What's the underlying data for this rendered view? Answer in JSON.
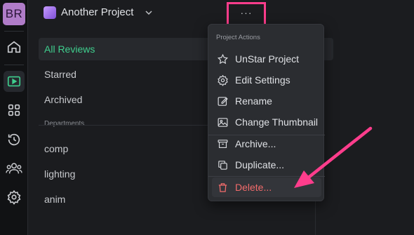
{
  "rail": {
    "avatar_initials": "BR",
    "items": [
      {
        "icon": "home-icon"
      },
      {
        "icon": "reviews-icon",
        "active": true
      },
      {
        "icon": "apps-grid-icon"
      },
      {
        "icon": "history-icon"
      },
      {
        "icon": "people-icon"
      },
      {
        "icon": "settings-gear-icon"
      }
    ]
  },
  "header": {
    "project_name": "Another Project",
    "more_label": "···"
  },
  "nav": {
    "items": [
      {
        "label": "All Reviews",
        "selected": true
      },
      {
        "label": "Starred"
      },
      {
        "label": "Archived"
      }
    ],
    "departments_header": "Departments",
    "departments": [
      {
        "label": "comp"
      },
      {
        "label": "lighting"
      },
      {
        "label": "anim"
      }
    ]
  },
  "menu": {
    "header": "Project Actions",
    "items": [
      {
        "label": "UnStar Project",
        "icon": "star-icon"
      },
      {
        "label": "Edit Settings",
        "icon": "gear-icon"
      },
      {
        "label": "Rename",
        "icon": "edit-pencil-icon"
      },
      {
        "label": "Change Thumbnail",
        "icon": "image-icon"
      },
      {
        "label": "Archive...",
        "icon": "archive-box-icon"
      },
      {
        "label": "Duplicate...",
        "icon": "duplicate-icon"
      },
      {
        "label": "Delete...",
        "icon": "trash-icon"
      }
    ]
  },
  "colors": {
    "accent_green": "#3fcf8e",
    "highlight_pink": "#ff3d8c",
    "danger_red": "#f26b6b",
    "avatar_purple": "#b07cc8"
  }
}
